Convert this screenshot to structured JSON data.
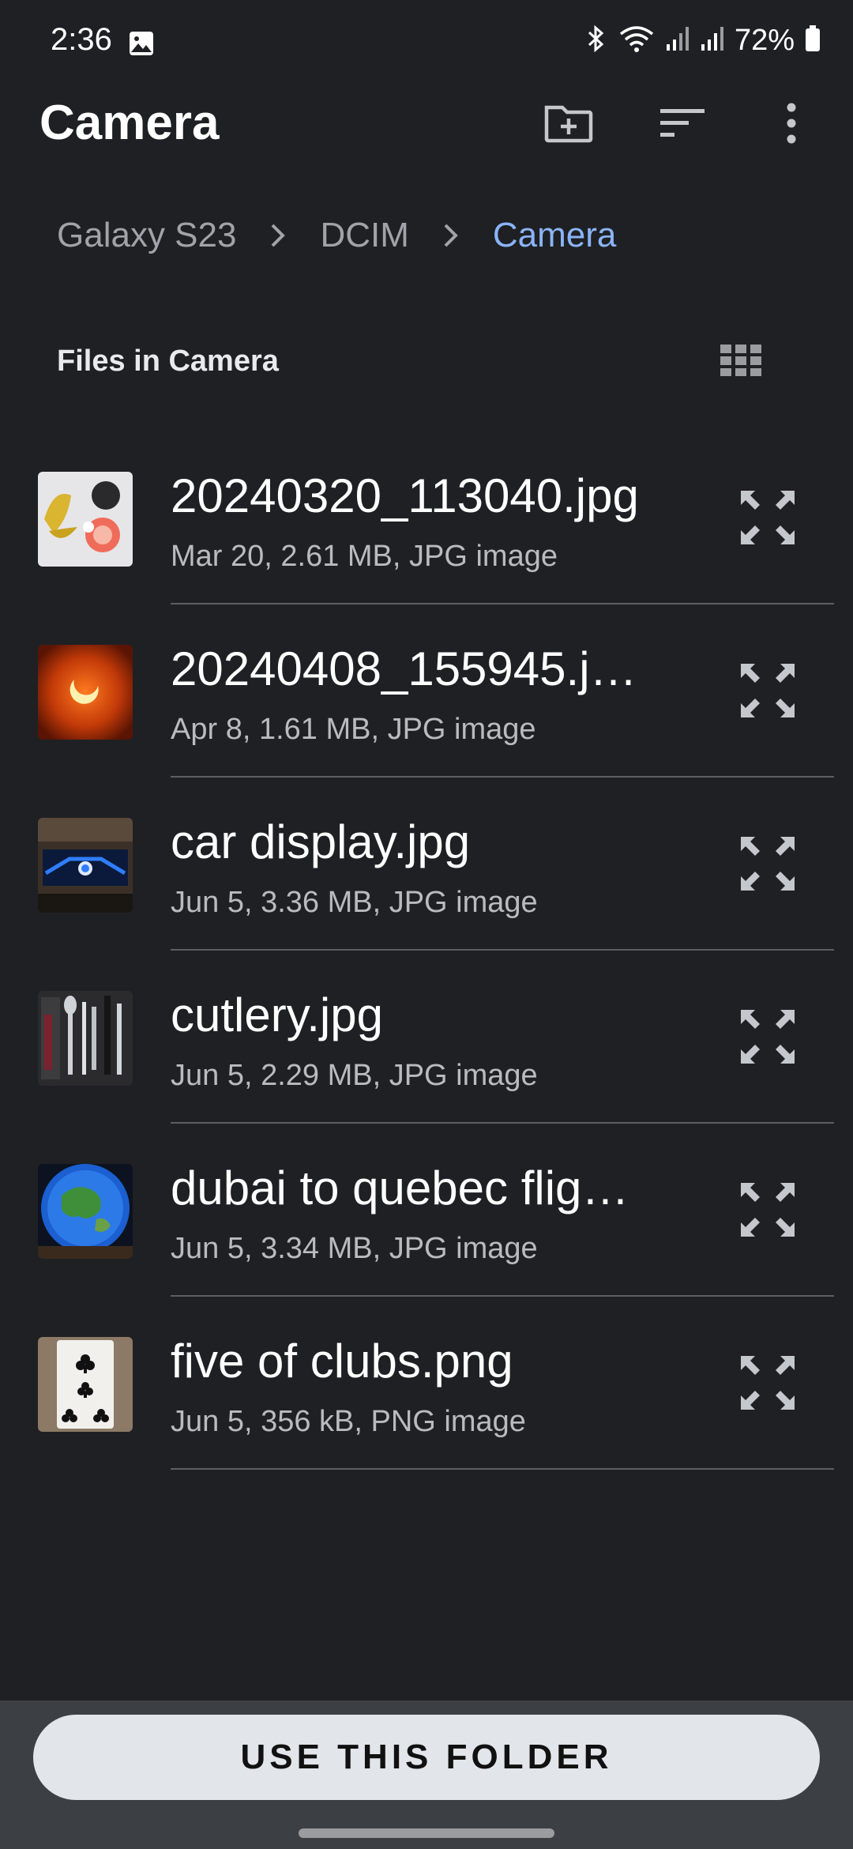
{
  "status_bar": {
    "time": "2:36",
    "battery": "72%",
    "icons": [
      "gallery-icon",
      "bluetooth-icon",
      "wifi-icon",
      "signal-icon",
      "signal-icon",
      "battery-icon"
    ]
  },
  "app_bar": {
    "title": "Camera",
    "actions": [
      "new-folder-icon",
      "sort-icon",
      "more-vert-icon"
    ]
  },
  "breadcrumb": {
    "items": [
      "Galaxy S23",
      "DCIM",
      "Camera"
    ]
  },
  "section": {
    "title": "Files in Camera",
    "view_toggle": "grid-view-icon"
  },
  "files": [
    {
      "name": "20240320_113040.jpg",
      "meta": "Mar 20, 2.61 MB, JPG image"
    },
    {
      "name": "20240408_155945.j…",
      "meta": "Apr 8, 1.61 MB, JPG image"
    },
    {
      "name": "car display.jpg",
      "meta": "Jun 5, 3.36 MB, JPG image"
    },
    {
      "name": "cutlery.jpg",
      "meta": "Jun 5, 2.29 MB, JPG image"
    },
    {
      "name": "dubai to quebec flig…",
      "meta": "Jun 5, 3.34 MB, JPG image"
    },
    {
      "name": "five of clubs.png",
      "meta": "Jun 5, 356 kB, PNG image"
    }
  ],
  "bottom": {
    "button_label": "USE THIS FOLDER"
  },
  "colors": {
    "background": "#1f2024",
    "accent": "#8ab4f8",
    "button_bg": "#e2e5ea",
    "bottom_panel": "#3c3f43"
  }
}
